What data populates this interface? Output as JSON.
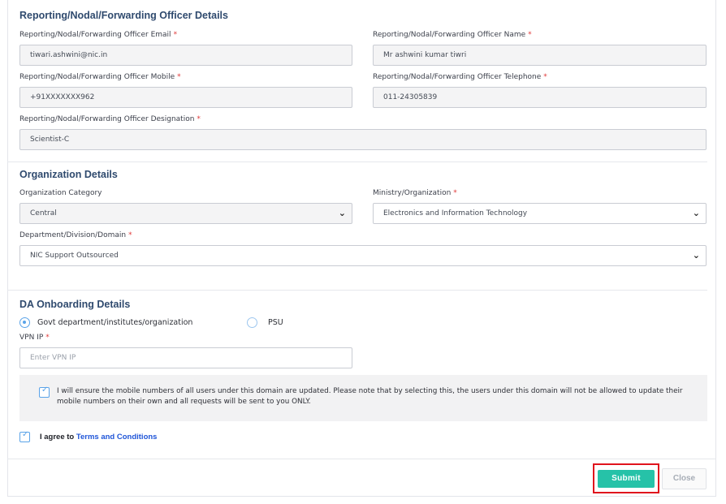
{
  "reporting": {
    "section_title": "Reporting/Nodal/Forwarding Officer Details",
    "email": {
      "label": "Reporting/Nodal/Forwarding Officer Email",
      "value": "tiwari.ashwini@nic.in"
    },
    "name": {
      "label": "Reporting/Nodal/Forwarding Officer Name",
      "value": "Mr ashwini kumar tiwri"
    },
    "mobile": {
      "label": "Reporting/Nodal/Forwarding Officer Mobile",
      "value": "+91XXXXXXX962"
    },
    "telephone": {
      "label": "Reporting/Nodal/Forwarding Officer Telephone",
      "value": "011-24305839"
    },
    "designation": {
      "label": "Reporting/Nodal/Forwarding Officer Designation",
      "value": "Scientist-C"
    },
    "required_mark": "*"
  },
  "organization": {
    "section_title": "Organization Details",
    "category": {
      "label": "Organization Category",
      "value": "Central"
    },
    "ministry": {
      "label": "Ministry/Organization",
      "value": "Electronics and Information Technology"
    },
    "department": {
      "label": "Department/Division/Domain",
      "value": "NIC Support Outsourced"
    }
  },
  "onboarding": {
    "section_title": "DA Onboarding Details",
    "options": [
      {
        "label": "Govt department/institutes/organization",
        "selected": true
      },
      {
        "label": "PSU",
        "selected": false
      }
    ],
    "vpn": {
      "label": "VPN IP",
      "placeholder": "Enter VPN IP"
    }
  },
  "notice": {
    "checked": true,
    "text": "I will ensure the mobile numbers of all users under this domain are updated. Please note that by selecting this, the users under this domain will not be allowed to update their mobile numbers on their own and all requests will be sent to you ONLY."
  },
  "agreement": {
    "checked": true,
    "prefix": "I agree to ",
    "link": "Terms and Conditions"
  },
  "footer": {
    "submit_label": "Submit",
    "close_label": "Close"
  },
  "colors": {
    "section_title": "#2f4a6e",
    "required": "#e03a3a",
    "accent": "#5aa3e8",
    "submit_bg": "#26c2a8",
    "highlight": "#e0141d",
    "link": "#1f55d8"
  },
  "icons": [
    "chevron-down-icon",
    "radio-icon",
    "checkbox-check-icon"
  ]
}
